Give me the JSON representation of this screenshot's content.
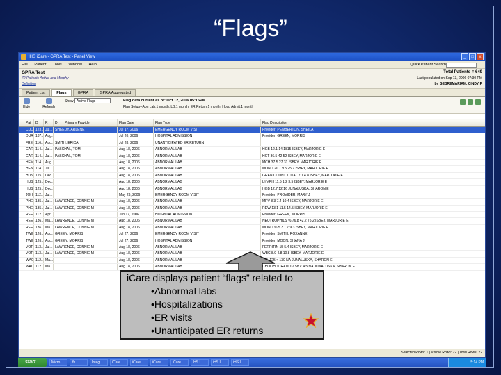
{
  "slide": {
    "title": "“Flags”"
  },
  "window": {
    "title": "IHS iCare - GPRA Test - Panel View",
    "buttons": [
      "_",
      "□",
      "x"
    ],
    "menu": [
      "File",
      "Patient",
      "Tools",
      "Window",
      "Help"
    ],
    "quick_search_label": "Quick Patient Search"
  },
  "header": {
    "panel_name": "GPRA Test",
    "description": "72 Patients Active and Murphy",
    "definition_link": "Definition",
    "total_patients": "Total Patients = 649",
    "populated": "Last populated on Sep 13, 2006 07:30 PM",
    "owner": "by GEBREMARIAM, CINDY P"
  },
  "tabs": [
    "Patient List",
    "Flags",
    "GPRA",
    "GPRA Aggregated"
  ],
  "toolbar": {
    "buttons": [
      "Hide",
      "Refresh"
    ],
    "show_label": "Show",
    "show_value": "Active Flags",
    "flag_data_current": "Flag data current as of: Oct 12, 2006 05:15PM",
    "flag_setup": "Flag Setup--Abn Lab:1 month; LB:1 month; ER Return:1 month; Hosp Admit:1 month"
  },
  "grid": {
    "columns": [
      "",
      "Pat",
      "D",
      "R",
      "D",
      "Primary Provider",
      "Flag Date",
      "Flag Type",
      "Flag Description"
    ],
    "rows": [
      [
        "CUO...",
        "123...",
        "Jul...",
        "SHEEDY, ARLENE",
        "Jul 17, 2006",
        "EMERGENCY ROOM VISIT",
        "Provider: PEMBERTON, SHEILA",
        true
      ],
      [
        "DURI...",
        "137...",
        "Aug...",
        "",
        "Jul 20, 2006",
        "HOSPITAL ADMISSION",
        "Provider: GREEN, MORRIS",
        false
      ],
      [
        "FRE...",
        "116...",
        "Aug...",
        "SMITH, ERICA",
        "Jul 28, 2006",
        "UNANTICIPATED ER RETURN",
        "",
        false
      ],
      [
        "GARC...",
        "114...",
        "Jul...",
        "PASCHAL, TOM",
        "Aug 18, 2006",
        "ABNORMAL LAB",
        "HGB 12.1 14.1815 ISBEY, MARJORIE E",
        false
      ],
      [
        "GARC...",
        "114...",
        "Jul...",
        "PASCHAL, TOM",
        "Aug 18, 2006",
        "ABNORMAL LAB",
        "HCT 36.5 42 52 ISBEY, MARJORIE E",
        false
      ],
      [
        "HEMP...",
        "114...",
        "Aug...",
        "",
        "Aug 18, 2006",
        "ABNORMAL LAB",
        "MCH 37.5 27 31 ISBEY, MARJORIE E",
        false
      ],
      [
        "HENK...",
        "114...",
        "Jul...",
        "",
        "Aug 18, 2006",
        "ABNORMAL LAB",
        "MONO 20.7 9.5 25.7 ISBEY, MARJORIE E",
        false
      ],
      [
        "HUSK...",
        "125...",
        "Dec...",
        "",
        "Aug 18, 2006",
        "ABNORMAL LAB",
        "GRAN COUNT TOTAL 2.1 4.8 ISBEY, MARJORIE E",
        false
      ],
      [
        "HUSK...",
        "125...",
        "Dec...",
        "",
        "Aug 18, 2006",
        "ABNORMAL LAB",
        "LYMPH 11.5 1.2 3.5 ISBEY, MARJORIE E",
        false
      ],
      [
        "HUSK...",
        "125...",
        "Dec...",
        "",
        "Aug 18, 2006",
        "ABNORMAL LAB",
        "HGB 12.7 12 16 JUNALUSKA, SHARON E",
        false
      ],
      [
        "JOHN...",
        "112...",
        "Jul...",
        "",
        "May 23, 2006",
        "EMERGENCY ROOM VISIT",
        "Provider: PROVIDER, MARY J",
        false
      ],
      [
        "PHEA...",
        "135...",
        "Jul...",
        "LAWRENCE, CONNIE M",
        "Aug 18, 2006",
        "ABNORMAL LAB",
        "MPV 8.3 7.4 10.4 ISBEY, MARJORIE E",
        false
      ],
      [
        "PHEA...",
        "135...",
        "Jul...",
        "LAWRENCE, CONNIE M",
        "Aug 18, 2006",
        "ABNORMAL LAB",
        "RDW 13.1 11.5 14.5 ISBEY, MARJORIE E",
        false
      ],
      [
        "REED...",
        "112...",
        "Apr...",
        "",
        "Jun 17, 2006",
        "HOSPITAL ADMISSION",
        "Provider: GREEN, MORRIS",
        false
      ],
      [
        "REED...",
        "136...",
        "Ma...",
        "LAWRENCE, CONNIE M",
        "Aug 18, 2006",
        "ABNORMAL LAB",
        "NEUTROPHILS % 76.8 42.2 75.2 ISBEY, MARJORIE E",
        false
      ],
      [
        "REED...",
        "136...",
        "Ma...",
        "LAWRENCE, CONNIE M",
        "Aug 18, 2006",
        "ABNORMAL LAB",
        "MONO % 5.3 1.7 9.3 ISBEY, MARJORIE E",
        false
      ],
      [
        "TWIN...",
        "126...",
        "Aug...",
        "GREEN, MORRIS",
        "Jul 27, 2006",
        "EMERGENCY ROOM VISIT",
        "Provider: SMITH, ROXANNE",
        false
      ],
      [
        "TWIN...",
        "126...",
        "Aug...",
        "GREEN, MORRIS",
        "Jul 27, 2006",
        "HOSPITAL ADMISSION",
        "Provider: MOON, SHANA J",
        false
      ],
      [
        "VOTR...",
        "113...",
        "Jul...",
        "LAWRENCE, CONNIE M",
        "Aug 18, 2006",
        "ABNORMAL LAB",
        "FERRITIN 15 5.4 ISBEY, MARJORIE E",
        false
      ],
      [
        "VOTR...",
        "113...",
        "Jul...",
        "LAWRENCE, CONNIE M",
        "Aug 18, 2006",
        "ABNORMAL LAB",
        "WBC 8.9 4.8 10.8 ISBEY, MARJORIE E",
        false
      ],
      [
        "WAC...",
        "112...",
        "Ma...",
        "",
        "Aug 18, 2006",
        "ABNORMAL LAB",
        "LDL 125 < 130 NA JUNALUSKA, SHARON E",
        false
      ],
      [
        "WAC...",
        "112...",
        "Ma...",
        "",
        "Aug 18, 2006",
        "ABNORMAL LAB",
        "CHOL/HDL RATIO 2.58 < 4.5 NA JUNALUSKA, SHARON E",
        false
      ]
    ]
  },
  "statusbar": {
    "right": "Selected Rows: 1 | Visible Rows: 22 | Total Rows: 22"
  },
  "taskbar": {
    "start": "start",
    "items": [
      "Micro...",
      "ifh...",
      "Integ...",
      "iCare...",
      "iCare...",
      "iCare...",
      "iCare...",
      "iHS I...",
      "iHS I...",
      "iHS I..."
    ],
    "clock": "5:14 PM"
  },
  "callout": {
    "lead": "iCare displays patient “flags” related to",
    "bullets": [
      "•Abnormal labs",
      "•Hospitalizations",
      "•ER visits",
      "•Unanticipated ER returns"
    ]
  },
  "colors": {
    "slide_bg": "#10286a",
    "selected_row": "#2f5fce",
    "callout_bg": "#bdbdbd",
    "arrow": "#9a9a9a",
    "star": "#c8102e"
  }
}
